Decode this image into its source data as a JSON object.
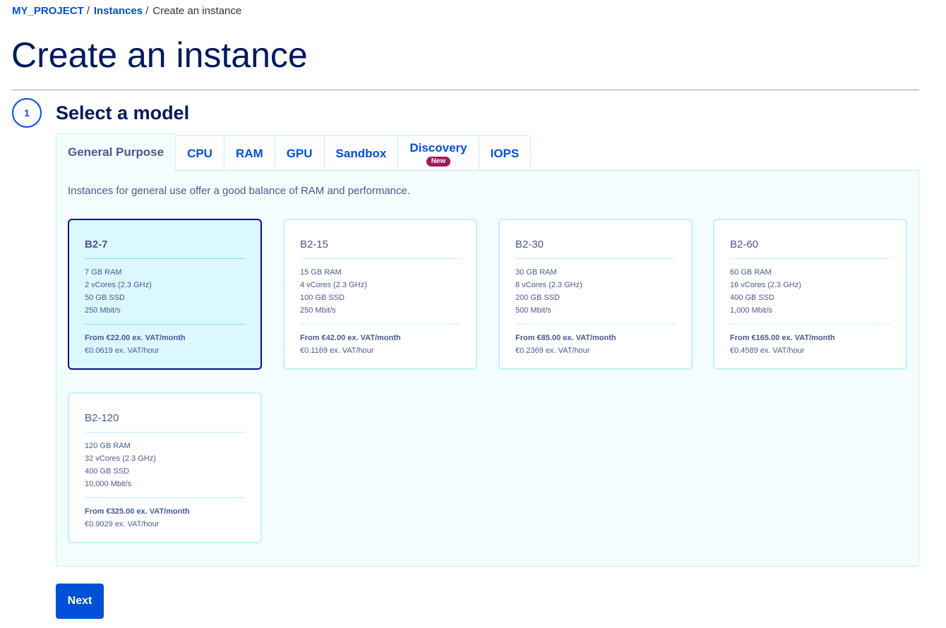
{
  "breadcrumb": {
    "project": "MY_PROJECT",
    "instances": "Instances",
    "current": "Create an instance",
    "separator": "/"
  },
  "page_title": "Create an instance",
  "step": {
    "number": "1",
    "title": "Select a model"
  },
  "tabs": [
    {
      "label": "General Purpose",
      "active": true
    },
    {
      "label": "CPU"
    },
    {
      "label": "RAM"
    },
    {
      "label": "GPU"
    },
    {
      "label": "Sandbox"
    },
    {
      "label": "Discovery",
      "badge": "New"
    },
    {
      "label": "IOPS"
    }
  ],
  "panel": {
    "description": "Instances for general use offer a good balance of RAM and performance."
  },
  "models": [
    {
      "name": "B2-7",
      "ram": "7 GB RAM",
      "vcores": "2 vCores (2.3 GHz)",
      "storage": "50 GB SSD",
      "bandwidth": "250 Mbit/s",
      "price_month": "From €22.00 ex. VAT/month",
      "price_hour": "€0.0619 ex. VAT/hour",
      "selected": true
    },
    {
      "name": "B2-15",
      "ram": "15 GB RAM",
      "vcores": "4 vCores (2.3 GHz)",
      "storage": "100 GB SSD",
      "bandwidth": "250 Mbit/s",
      "price_month": "From €42.00 ex. VAT/month",
      "price_hour": "€0.1169 ex. VAT/hour"
    },
    {
      "name": "B2-30",
      "ram": "30 GB RAM",
      "vcores": "8 vCores (2.3 GHz)",
      "storage": "200 GB SSD",
      "bandwidth": "500 Mbit/s",
      "price_month": "From €85.00 ex. VAT/month",
      "price_hour": "€0.2369 ex. VAT/hour"
    },
    {
      "name": "B2-60",
      "ram": "60 GB RAM",
      "vcores": "16 vCores (2.3 GHz)",
      "storage": "400 GB SSD",
      "bandwidth": "1,000 Mbit/s",
      "price_month": "From €165.00 ex. VAT/month",
      "price_hour": "€0.4589 ex. VAT/hour"
    },
    {
      "name": "B2-120",
      "ram": "120 GB RAM",
      "vcores": "32 vCores (2.3 GHz)",
      "storage": "400 GB SSD",
      "bandwidth": "10,000 Mbit/s",
      "price_month": "From €325.00 ex. VAT/month",
      "price_hour": "€0.9029 ex. VAT/hour"
    }
  ],
  "next_button": "Next"
}
